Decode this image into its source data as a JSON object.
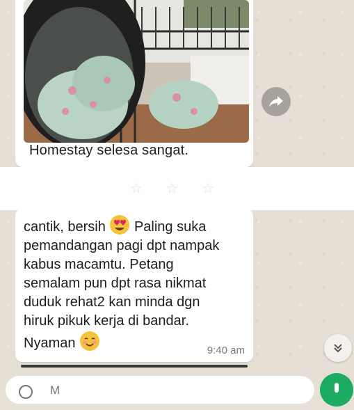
{
  "chat": {
    "photo_message": {
      "caption": "Homestay selesa sangat."
    },
    "decoration": {
      "stars": "☆ ☆ ☆"
    },
    "text_message": {
      "line1_part1": "cantik, bersih ",
      "line1_part2": " Paling suka",
      "body": "pemandangan pagi dpt nampak\nkabus macamtu. Petang\nsemalam pun dpt rasa nikmat\nduduk rehat2 kan minda dgn\nhiruk pikuk kerja di bandar.",
      "closing": "Nyaman ",
      "time": "9:40 am"
    }
  },
  "input": {
    "placeholder": "M"
  },
  "colors": {
    "wallpaper": "#e6dfd6",
    "bubble": "#ffffff",
    "accent_green": "#1daa61",
    "forward_button": "#a7a39c"
  },
  "icons": {
    "forward": "forward-arrow-icon",
    "scroll_down": "chevron-double-down-icon",
    "emoji_heart_eyes": "heart-eyes-emoji",
    "emoji_smiling": "smiling-blush-emoji"
  }
}
